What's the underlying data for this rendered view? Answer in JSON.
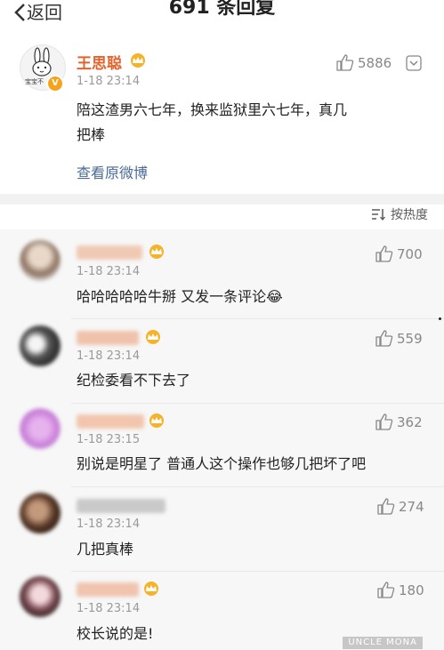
{
  "header": {
    "back_label": "返回",
    "title": "691 条回复"
  },
  "original_post": {
    "username": "王思聪",
    "avatar_caption": "宝宝不",
    "time": "1-18 23:14",
    "likes": "5886",
    "text_line1": "陪这渣男六七年，换来监狱里六七年，真几",
    "text_line2": "把棒",
    "view_original": "查看原微博"
  },
  "sort": {
    "label": "按热度"
  },
  "comments": [
    {
      "time": "1-18 23:14",
      "likes": "700",
      "text": "哈哈哈哈哈牛掰  又发一条评论😂"
    },
    {
      "time": "1-18 23:14",
      "likes": "559",
      "text": "纪检委看不下去了"
    },
    {
      "time": "1-18 23:15",
      "likes": "362",
      "text": "别说是明星了 普通人这个操作也够几把坏了吧"
    },
    {
      "time": "1-18 23:14",
      "likes": "274",
      "text": "几把真棒"
    },
    {
      "time": "1-18 23:14",
      "likes": "180",
      "text": "校长说的是!"
    }
  ],
  "watermark": "UNCLE MONA",
  "colors": {
    "username": "#e3632d",
    "link": "#4a6b96",
    "background_comments": "#f7f7f7",
    "separator": "#f2f2f2"
  },
  "icons": [
    "chevron-left-icon",
    "crown-icon",
    "thumbs-up-icon",
    "more-icon",
    "sort-icon",
    "verified-badge-icon"
  ]
}
